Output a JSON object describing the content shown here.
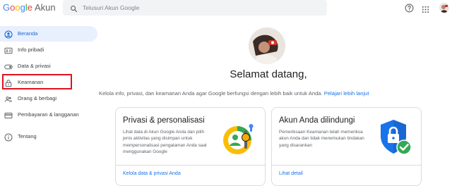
{
  "header": {
    "logo_letters": [
      "G",
      "o",
      "o",
      "g",
      "l",
      "e"
    ],
    "product_name": "Akun",
    "search_placeholder": "Telusuri Akun Google",
    "help_icon": "help-circle-icon",
    "apps_icon": "apps-grid-icon",
    "avatar_icon": "account-avatar"
  },
  "sidebar": {
    "items": [
      {
        "label": "Beranda",
        "icon": "account-circle-icon",
        "active": true
      },
      {
        "label": "Info pribadi",
        "icon": "id-card-icon",
        "active": false
      },
      {
        "label": "Data & privasi",
        "icon": "toggle-icon",
        "active": false
      },
      {
        "label": "Keamanan",
        "icon": "lock-icon",
        "active": false
      },
      {
        "label": "Orang & berbagi",
        "icon": "people-icon",
        "active": false
      },
      {
        "label": "Pembayaran & langganan",
        "icon": "credit-card-icon",
        "active": false
      },
      {
        "label": "Tentang",
        "icon": "info-icon",
        "active": false
      }
    ]
  },
  "main": {
    "welcome": "Selamat datang,",
    "subtitle": "Kelola info, privasi, dan keamanan Anda agar Google berfungsi dengan lebih baik untuk Anda.",
    "subtitle_link": "Pelajari lebih lanjut",
    "cards": [
      {
        "title": "Privasi & personalisasi",
        "description": "Lihat data di Akun Google Anda dan pilih jenis aktivitas yang disimpan untuk mempersonalisasi pengalaman Anda saat menggunakan Google",
        "link": "Kelola data & privasi Anda",
        "illustration": "privacy-personalization-illustration"
      },
      {
        "title": "Akun Anda dilindungi",
        "description": "Pemeriksaan Keamanan telah memeriksa akun Anda dan tidak menemukan tindakan yang disarankan",
        "link": "Lihat detail",
        "illustration": "shield-check-illustration"
      }
    ]
  },
  "colors": {
    "accent_blue": "#1a73e8",
    "active_nav_bg": "#e8f0fe",
    "highlight_red": "#e0131e",
    "shield_blue": "#1a73e8",
    "check_green": "#34a853"
  }
}
